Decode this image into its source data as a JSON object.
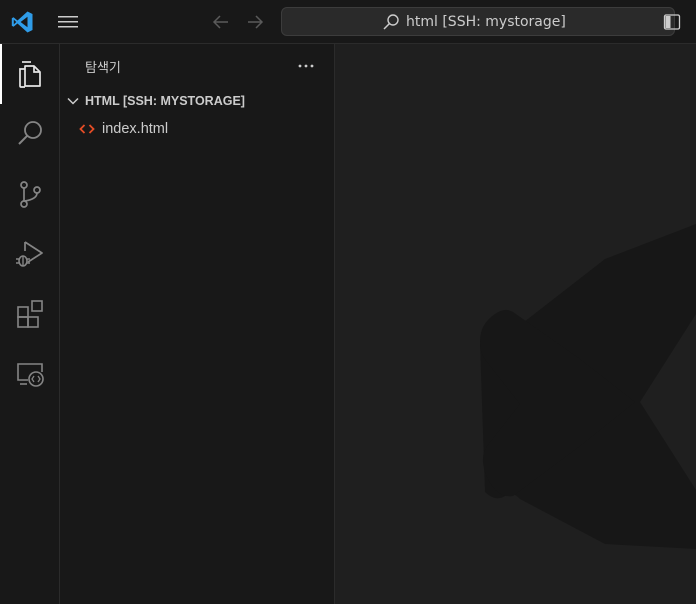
{
  "titlebar": {
    "command_center_text": "html [SSH: mystorage]"
  },
  "activity_bar": {
    "items": [
      {
        "icon": "files-icon",
        "active": true
      },
      {
        "icon": "search-icon",
        "active": false
      },
      {
        "icon": "source-control-icon",
        "active": false
      },
      {
        "icon": "run-debug-icon",
        "active": false
      },
      {
        "icon": "extensions-icon",
        "active": false
      },
      {
        "icon": "remote-explorer-icon",
        "active": false
      }
    ]
  },
  "sidebar": {
    "title": "탐색기",
    "folder": {
      "label": "HTML [SSH: MYSTORAGE]",
      "expanded": true
    },
    "files": [
      {
        "name": "index.html",
        "icon": "html-file-icon"
      }
    ]
  },
  "colors": {
    "accent": "#0078d4",
    "html_icon": "#e44d26",
    "background": "#1f1f1f",
    "chrome": "#181818"
  }
}
